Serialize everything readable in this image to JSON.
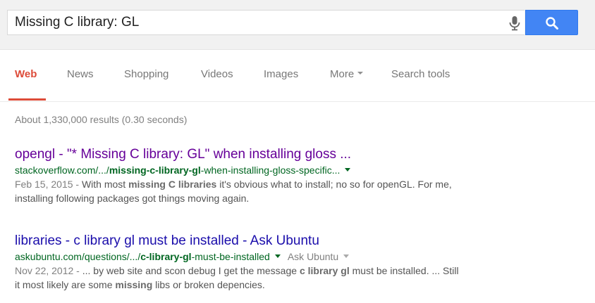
{
  "search": {
    "query": "Missing C library: GL",
    "mic_icon": "microphone-icon",
    "button_icon": "search-icon",
    "button_color": "#4285f4"
  },
  "tabs": [
    {
      "label": "Web",
      "active": true
    },
    {
      "label": "News"
    },
    {
      "label": "Shopping"
    },
    {
      "label": "Videos"
    },
    {
      "label": "Images"
    },
    {
      "label": "More"
    },
    {
      "label": "Search tools"
    }
  ],
  "stats": "About 1,330,000 results (0.30 seconds)",
  "results": [
    {
      "title": "opengl - \"* Missing C library: GL\" when installing gloss ...",
      "url_pre": "stackoverflow.com/.../",
      "url_bold": "missing-c-library-gl",
      "url_post": "-when-installing-gloss-specific...",
      "date": "Feb 15, 2015 - ",
      "snippet_1": "With most ",
      "snippet_b1": "missing C libraries",
      "snippet_2": " it's obvious what to install; no so for openGL. For me, installing following packages got things moving again."
    },
    {
      "title": "libraries - c library gl must be installed - Ask Ubuntu",
      "url_pre": "askubuntu.com/questions/.../",
      "url_bold": "c-library-gl",
      "url_post": "-must-be-installed",
      "site_name": "Ask Ubuntu",
      "date": "Nov 22, 2012 - ",
      "snippet_1": "... by web site and scon debug I get the message ",
      "snippet_b1": "c library gl",
      "snippet_2": " must be installed. ... Still it most likely are some ",
      "snippet_b2": "missing",
      "snippet_3": " libs or broken depencies."
    }
  ],
  "colors": {
    "active_tab": "#dd4b39",
    "visited_link": "#660099",
    "link": "#1a0dab",
    "url": "#006621"
  }
}
